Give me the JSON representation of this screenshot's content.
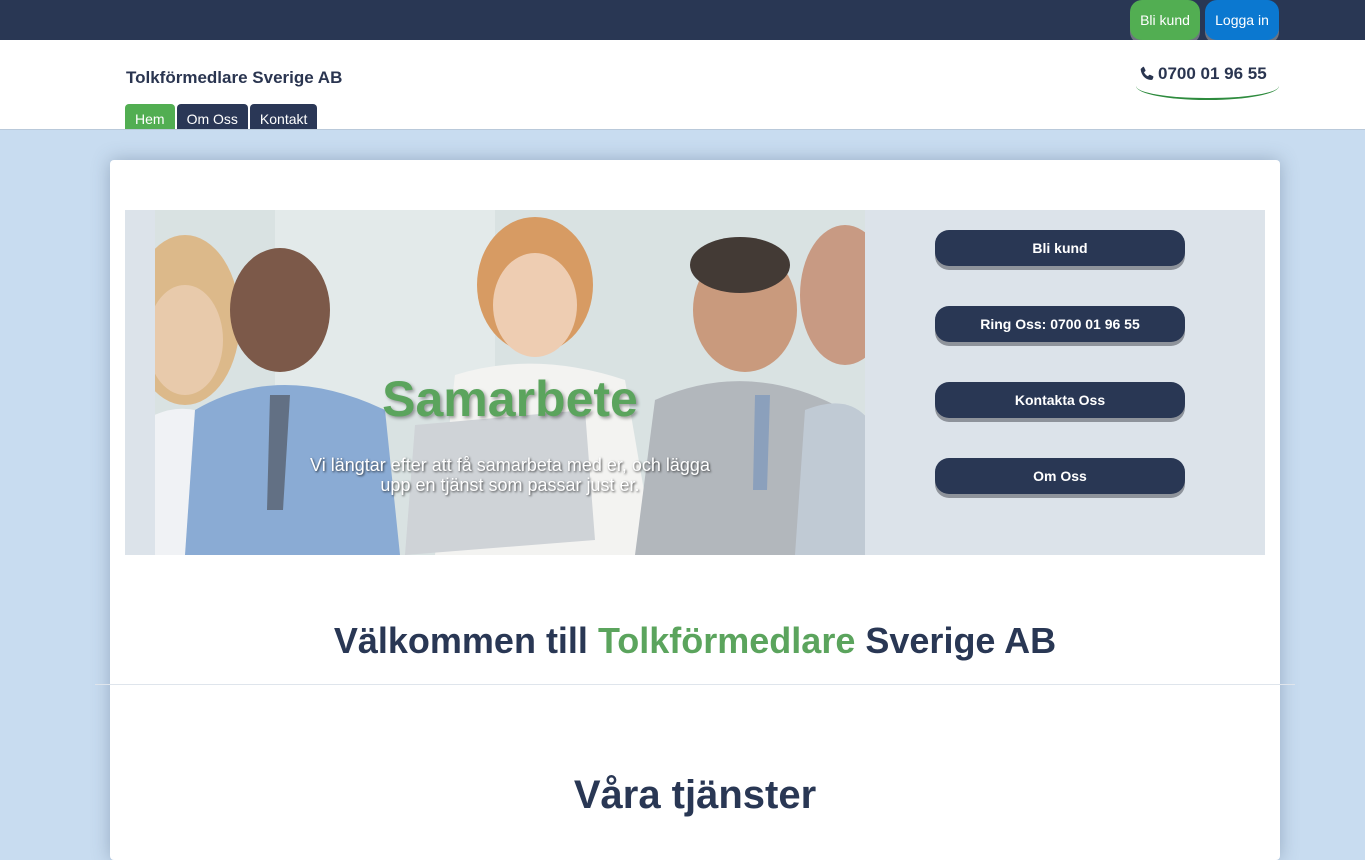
{
  "topbar": {
    "register_label": "Bli kund",
    "login_label": "Logga in"
  },
  "header": {
    "brand": "Tolkförmedlare Sverige AB",
    "phone": "0700 01 96 55",
    "nav": [
      {
        "label": "Hem",
        "active": true
      },
      {
        "label": "Om Oss",
        "active": false
      },
      {
        "label": "Kontakt",
        "active": false
      }
    ]
  },
  "hero": {
    "title": "Samarbete",
    "subtitle": "Vi längtar efter att få samarbeta med er, och lägga upp en tjänst som passar just er."
  },
  "sidebar_buttons": [
    {
      "label": "Bli kund"
    },
    {
      "label": "Ring Oss: 0700 01 96 55"
    },
    {
      "label": "Kontakta Oss"
    },
    {
      "label": "Om Oss"
    }
  ],
  "welcome": {
    "prefix": "Välkommen till",
    "highlight": "Tolkförmedlare",
    "suffix": "Sverige AB"
  },
  "services_heading": "Våra tjänster",
  "colors": {
    "navy": "#293754",
    "green": "#52ae52",
    "blue": "#0b78d0",
    "page_bg": "#c8dcf0"
  }
}
